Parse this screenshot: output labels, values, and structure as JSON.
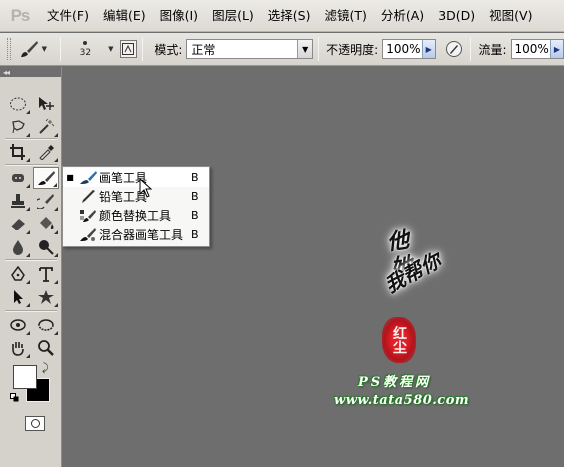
{
  "app": {
    "logo": "Ps"
  },
  "menu": [
    "文件(F)",
    "编辑(E)",
    "图像(I)",
    "图层(L)",
    "选择(S)",
    "滤镜(T)",
    "分析(A)",
    "3D(D)",
    "视图(V)"
  ],
  "options": {
    "brush_size": "32",
    "mode_label": "模式:",
    "mode_value": "正常",
    "opacity_label": "不透明度:",
    "opacity_value": "100%",
    "flow_label": "流量:",
    "flow_value": "100%"
  },
  "panel": {
    "collapse_glyph": "◂◂"
  },
  "flyout": {
    "items": [
      {
        "label": "画笔工具",
        "key": "B",
        "icon": "brush-icon",
        "selected": true
      },
      {
        "label": "铅笔工具",
        "key": "B",
        "icon": "pencil-icon",
        "selected": false
      },
      {
        "label": "颜色替换工具",
        "key": "B",
        "icon": "color-replacement-icon",
        "selected": false
      },
      {
        "label": "混合器画笔工具",
        "key": "B",
        "icon": "mixer-brush-icon",
        "selected": false
      }
    ]
  },
  "watermark": {
    "line1": "他她",
    "line2": "我帮你",
    "seal": "红尘",
    "site_name": "PS教程网",
    "site_url": "www.tata580.com"
  },
  "colors": {
    "foreground": "#ffffff",
    "background": "#000000",
    "canvas": "#6e6e6e"
  }
}
